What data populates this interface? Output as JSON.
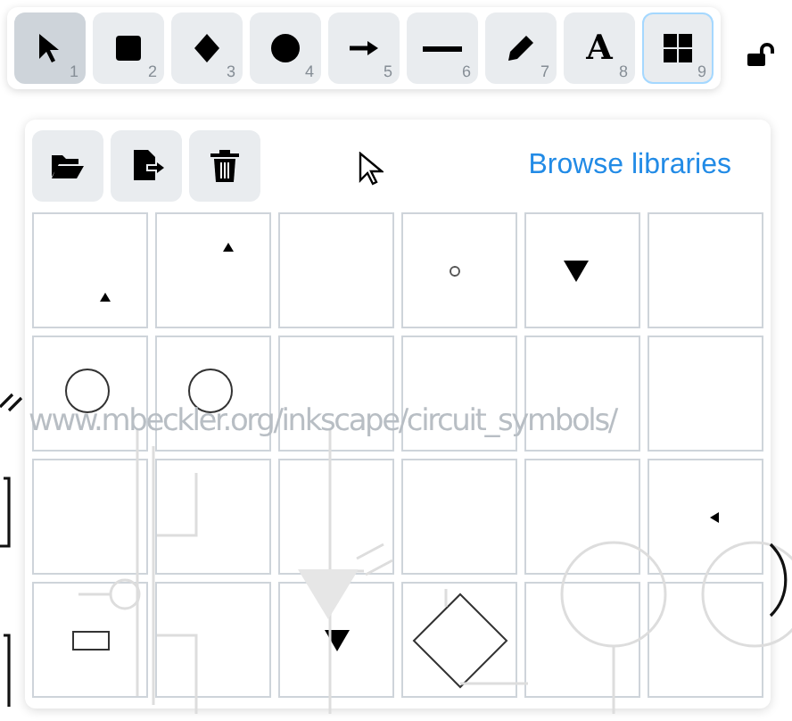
{
  "toolbar": {
    "tools": [
      {
        "kind": "select",
        "shortcut": "1",
        "selected": false,
        "highlighted": true
      },
      {
        "kind": "rectangle",
        "shortcut": "2",
        "selected": false,
        "highlighted": false
      },
      {
        "kind": "diamond",
        "shortcut": "3",
        "selected": false,
        "highlighted": false
      },
      {
        "kind": "ellipse",
        "shortcut": "4",
        "selected": false,
        "highlighted": false
      },
      {
        "kind": "arrow",
        "shortcut": "5",
        "selected": false,
        "highlighted": false
      },
      {
        "kind": "line",
        "shortcut": "6",
        "selected": false,
        "highlighted": false
      },
      {
        "kind": "pencil",
        "shortcut": "7",
        "selected": false,
        "highlighted": false
      },
      {
        "kind": "text",
        "shortcut": "8",
        "glyph": "A",
        "selected": false,
        "highlighted": false
      },
      {
        "kind": "library",
        "shortcut": "9",
        "selected": true,
        "highlighted": false
      }
    ],
    "locked": false
  },
  "library": {
    "actions": [
      {
        "kind": "open"
      },
      {
        "kind": "export"
      },
      {
        "kind": "delete"
      }
    ],
    "browse_link": "Browse libraries",
    "items": [
      {
        "kind": "triangle-low"
      },
      {
        "kind": "triangle-high"
      },
      {
        "kind": "empty"
      },
      {
        "kind": "dot"
      },
      {
        "kind": "triangle-down"
      },
      {
        "kind": "empty"
      },
      {
        "kind": "circle"
      },
      {
        "kind": "circle"
      },
      {
        "kind": "empty"
      },
      {
        "kind": "empty"
      },
      {
        "kind": "empty"
      },
      {
        "kind": "empty"
      },
      {
        "kind": "empty"
      },
      {
        "kind": "empty"
      },
      {
        "kind": "empty"
      },
      {
        "kind": "empty"
      },
      {
        "kind": "empty"
      },
      {
        "kind": "triangle-left"
      },
      {
        "kind": "rect"
      },
      {
        "kind": "empty"
      },
      {
        "kind": "triangle-down-small"
      },
      {
        "kind": "diamond"
      },
      {
        "kind": "empty"
      },
      {
        "kind": "empty"
      }
    ]
  },
  "canvas": {
    "text": "www.mbeckler.org/inkscape/circuit_symbols/"
  }
}
